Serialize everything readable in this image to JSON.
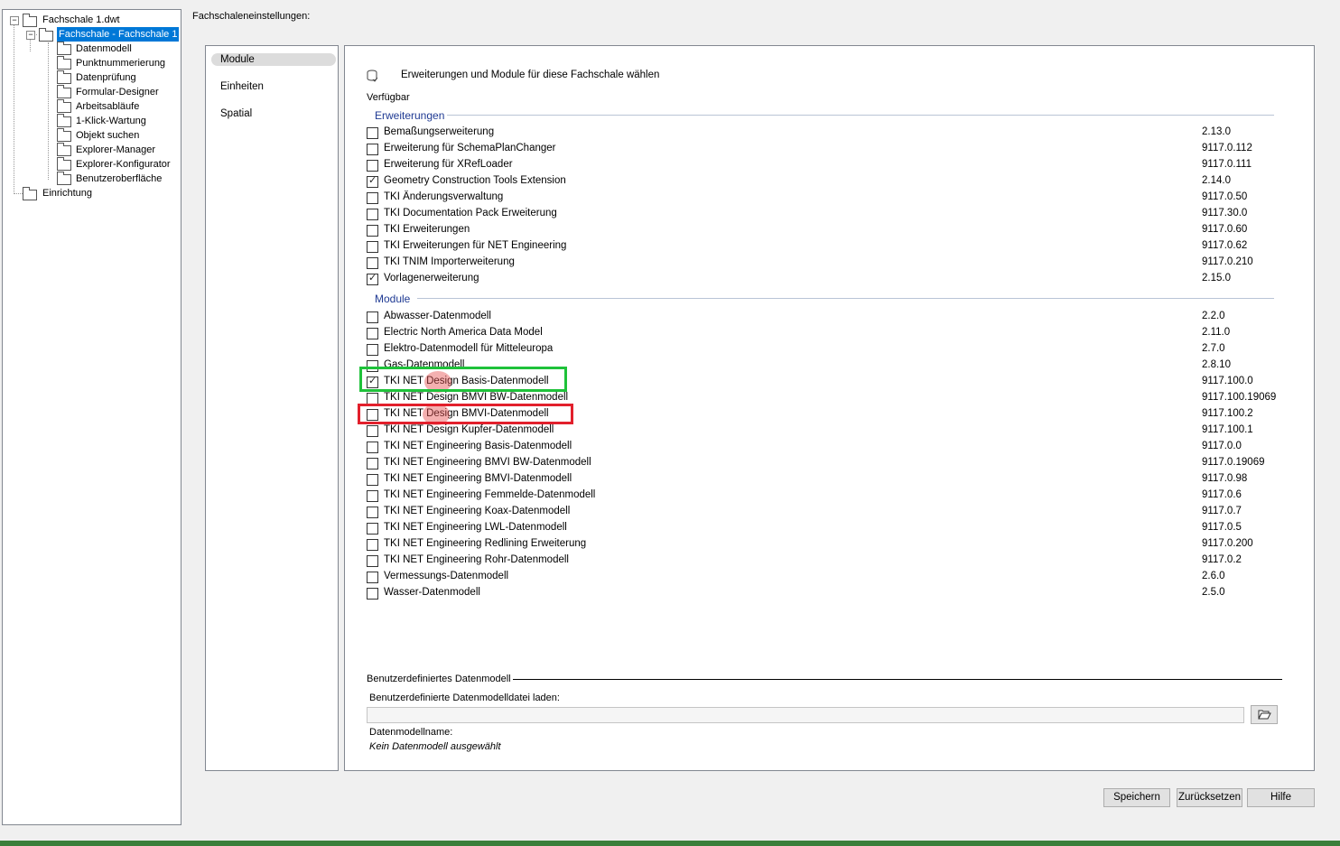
{
  "tree": {
    "root": "Fachschale 1.dwt",
    "selected": "Fachschale - Fachschale 1",
    "children": [
      "Datenmodell",
      "Punktnummerierung",
      "Datenprüfung",
      "Formular-Designer",
      "Arbeitsabläufe",
      "1-Klick-Wartung",
      "Objekt suchen",
      "Explorer-Manager",
      "Explorer-Konfigurator",
      "Benutzeroberfläche"
    ],
    "sibling": "Einrichtung"
  },
  "settings_title": "Fachschaleneinstellungen:",
  "categories": [
    "Module",
    "Einheiten",
    "Spatial"
  ],
  "main": {
    "header": "Erweiterungen und Module für diese Fachschale wählen",
    "available": "Verfügbar",
    "sections": [
      {
        "title": "Erweiterungen",
        "items": [
          {
            "name": "Bemaßungserweiterung",
            "version": "2.13.0",
            "checked": false
          },
          {
            "name": "Erweiterung für SchemaPlanChanger",
            "version": "9117.0.112",
            "checked": false
          },
          {
            "name": "Erweiterung für XRefLoader",
            "version": "9117.0.111",
            "checked": false
          },
          {
            "name": "Geometry Construction Tools Extension",
            "version": "2.14.0",
            "checked": true
          },
          {
            "name": "TKI Änderungsverwaltung",
            "version": "9117.0.50",
            "checked": false
          },
          {
            "name": "TKI Documentation Pack Erweiterung",
            "version": "9117.30.0",
            "checked": false
          },
          {
            "name": "TKI Erweiterungen",
            "version": "9117.0.60",
            "checked": false
          },
          {
            "name": "TKI Erweiterungen für NET Engineering",
            "version": "9117.0.62",
            "checked": false
          },
          {
            "name": "TKI TNIM Importerweiterung",
            "version": "9117.0.210",
            "checked": false
          },
          {
            "name": "Vorlagenerweiterung",
            "version": "2.15.0",
            "checked": true
          }
        ]
      },
      {
        "title": "Module",
        "items": [
          {
            "name": "Abwasser-Datenmodell",
            "version": "2.2.0",
            "checked": false
          },
          {
            "name": "Electric North America Data Model",
            "version": "2.11.0",
            "checked": false
          },
          {
            "name": "Elektro-Datenmodell für Mitteleuropa",
            "version": "2.7.0",
            "checked": false
          },
          {
            "name": "Gas-Datenmodell",
            "version": "2.8.10",
            "checked": false
          },
          {
            "name": "TKI NET Design Basis-Datenmodell",
            "version": "9117.100.0",
            "checked": true
          },
          {
            "name": "TKI NET Design BMVI BW-Datenmodell",
            "version": "9117.100.19069",
            "checked": false
          },
          {
            "name": "TKI NET Design BMVI-Datenmodell",
            "version": "9117.100.2",
            "checked": false
          },
          {
            "name": "TKI NET Design Kupfer-Datenmodell",
            "version": "9117.100.1",
            "checked": false
          },
          {
            "name": "TKI NET Engineering Basis-Datenmodell",
            "version": "9117.0.0",
            "checked": false
          },
          {
            "name": "TKI NET Engineering BMVI BW-Datenmodell",
            "version": "9117.0.19069",
            "checked": false
          },
          {
            "name": "TKI NET Engineering BMVI-Datenmodell",
            "version": "9117.0.98",
            "checked": false
          },
          {
            "name": "TKI NET Engineering Femmelde-Datenmodell",
            "version": "9117.0.6",
            "checked": false
          },
          {
            "name": "TKI NET Engineering Koax-Datenmodell",
            "version": "9117.0.7",
            "checked": false
          },
          {
            "name": "TKI NET Engineering LWL-Datenmodell",
            "version": "9117.0.5",
            "checked": false
          },
          {
            "name": "TKI NET Engineering Redlining Erweiterung",
            "version": "9117.0.200",
            "checked": false
          },
          {
            "name": "TKI NET Engineering Rohr-Datenmodell",
            "version": "9117.0.2",
            "checked": false
          },
          {
            "name": "Vermessungs-Datenmodell",
            "version": "2.6.0",
            "checked": false
          },
          {
            "name": "Wasser-Datenmodell",
            "version": "2.5.0",
            "checked": false
          }
        ]
      }
    ],
    "custom": {
      "title": "Benutzerdefiniertes Datenmodell",
      "load_label": "Benutzerdefinierte Datenmodelldatei laden:",
      "path": "",
      "name_label": "Datenmodellname:",
      "name_value": "Kein Datenmodell ausgewählt"
    }
  },
  "buttons": {
    "save": "Speichern",
    "reset": "Zurücksetzen",
    "help": "Hilfe"
  },
  "colors": {
    "highlight_green": "#1fc23a",
    "highlight_red": "#e2202c",
    "selection": "#0078d7"
  }
}
